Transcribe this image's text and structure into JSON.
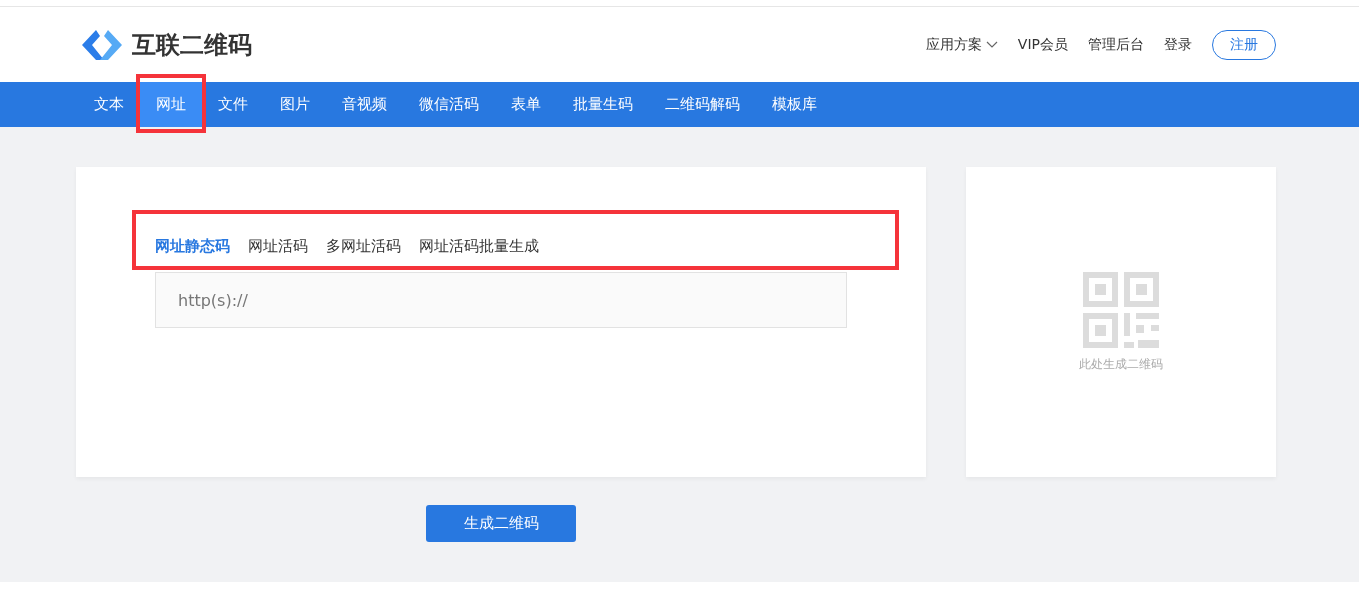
{
  "header": {
    "logo_text": "互联二维码",
    "links": [
      {
        "label": "应用方案",
        "dropdown": true
      },
      {
        "label": "VIP会员",
        "dropdown": false
      },
      {
        "label": "管理后台",
        "dropdown": false
      },
      {
        "label": "登录",
        "dropdown": false
      }
    ],
    "register_button": "注册"
  },
  "nav": [
    {
      "label": "文本",
      "selected": false,
      "highlighted": false
    },
    {
      "label": "网址",
      "selected": true,
      "highlighted": true
    },
    {
      "label": "文件",
      "selected": false,
      "highlighted": false
    },
    {
      "label": "图片",
      "selected": false,
      "highlighted": false
    },
    {
      "label": "音视频",
      "selected": false,
      "highlighted": false
    },
    {
      "label": "微信活码",
      "selected": false,
      "highlighted": false
    },
    {
      "label": "表单",
      "selected": false,
      "highlighted": false
    },
    {
      "label": "批量生码",
      "selected": false,
      "highlighted": false
    },
    {
      "label": "二维码解码",
      "selected": false,
      "highlighted": false
    },
    {
      "label": "模板库",
      "selected": false,
      "highlighted": false
    }
  ],
  "sub_tabs": {
    "highlighted": true,
    "items": [
      {
        "label": "网址静态码",
        "selected": true
      },
      {
        "label": "网址活码",
        "selected": false
      },
      {
        "label": "多网址活码",
        "selected": false
      },
      {
        "label": "网址活码批量生成",
        "selected": false
      }
    ]
  },
  "url_input": {
    "placeholder": "http(s)://"
  },
  "preview": {
    "caption": "此处生成二维码"
  },
  "generate_button": "生成二维码"
}
